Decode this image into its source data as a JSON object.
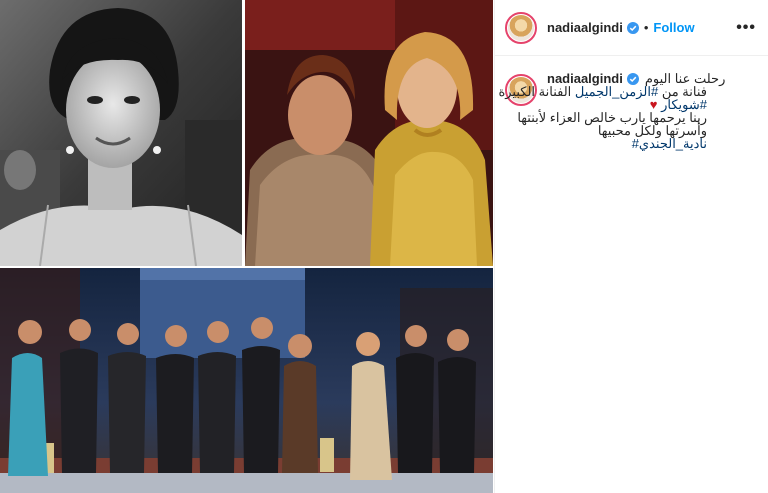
{
  "post": {
    "username": "nadiaalgindi",
    "follow_label": "Follow",
    "more_label": "•••",
    "dot": "•",
    "caption": {
      "line1": "رحلت عنا اليوم",
      "line2_prefix": "فنانة من ",
      "line2_tag": "#الزمن_الجميل",
      "line2_suffix": " الفنانة الكبيرة",
      "line3_tag": "#شويكار",
      "line3_heart": "♥",
      "line4": "ربنا يرحمها يارب خالص العزاء لأبنتها",
      "line5": "وأسرتها ولكل محبيها",
      "line6_tag": "نادية_الجندي#"
    }
  },
  "colors": {
    "link": "#0095f6",
    "hashtag": "#00376b",
    "verified": "#3897f0",
    "ring": "#e5436b"
  }
}
